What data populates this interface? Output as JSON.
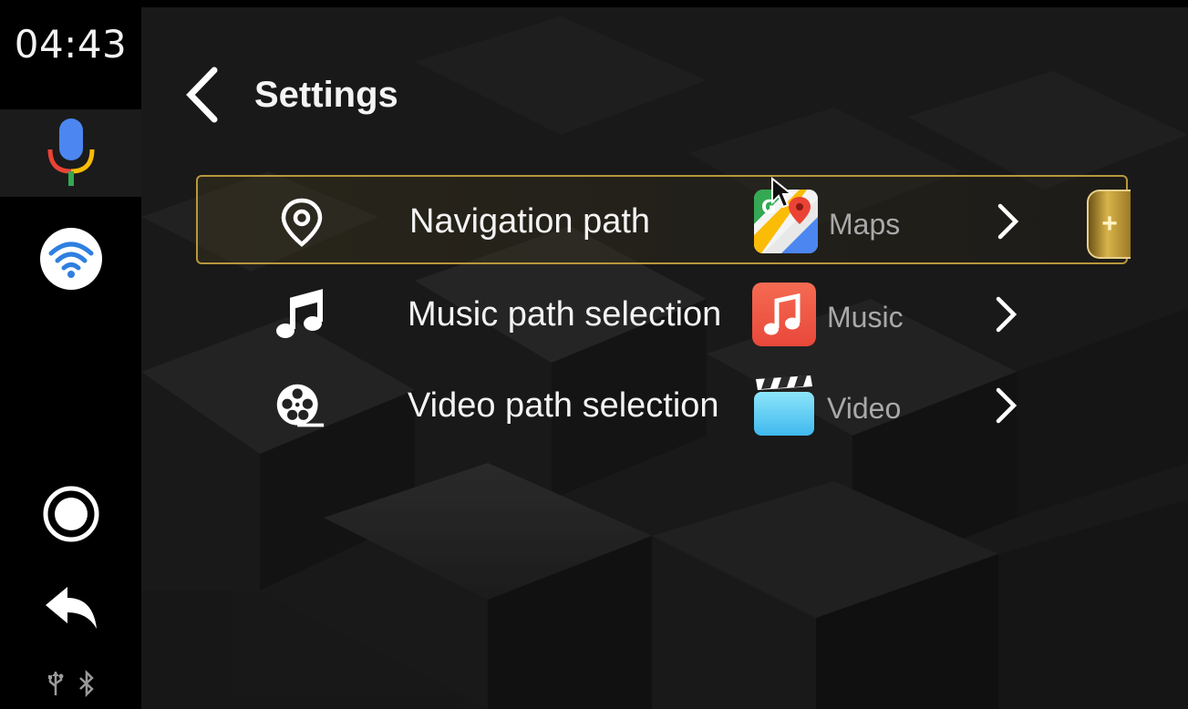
{
  "status_bar": {
    "time": "04:43"
  },
  "rail": {
    "items": [
      {
        "icon": "microphone-icon"
      },
      {
        "icon": "wifi-icon"
      },
      {
        "icon": "home-icon"
      },
      {
        "icon": "back-arrow-icon"
      }
    ],
    "status_icons": [
      "usb-icon",
      "bluetooth-icon"
    ]
  },
  "header": {
    "title": "Settings",
    "back_icon": "chevron-left-icon"
  },
  "settings": {
    "rows": [
      {
        "label": "Navigation path",
        "icon": "location-pin-icon",
        "app_name": "Maps",
        "app_icon": "maps-app-icon",
        "selected": true
      },
      {
        "label": "Music path selection",
        "icon": "music-note-icon",
        "app_name": "Music",
        "app_icon": "music-app-icon",
        "selected": false
      },
      {
        "label": "Video path selection",
        "icon": "film-reel-icon",
        "app_name": "Video",
        "app_icon": "video-app-icon",
        "selected": false
      }
    ]
  },
  "side_tab": {
    "label": "+"
  },
  "colors": {
    "accent_gold": "#b8973c",
    "background": "#1e1e1e",
    "rail": "#000000",
    "music_app": "#f0634a",
    "video_app": "#5fd2f4"
  }
}
